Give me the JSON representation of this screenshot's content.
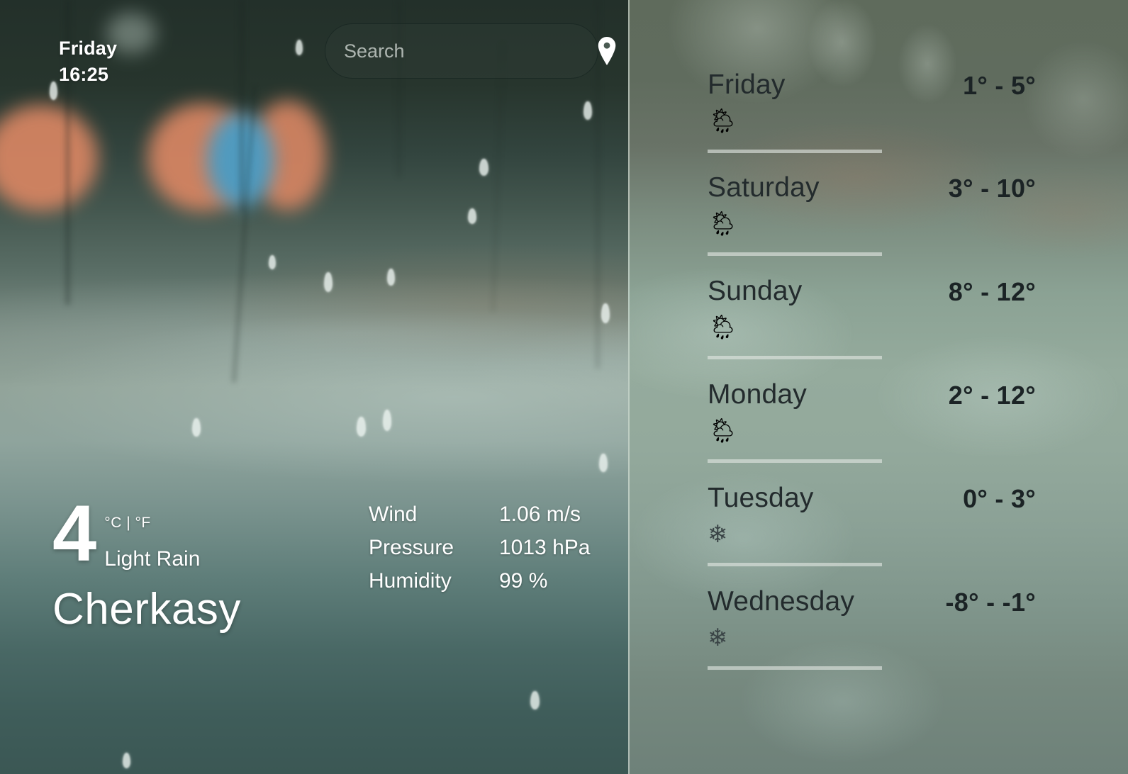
{
  "header": {
    "day": "Friday",
    "time": "16:25"
  },
  "search": {
    "placeholder": "Search",
    "value": "",
    "location_icon": "location-pin-icon"
  },
  "current": {
    "temperature": "4",
    "units_toggle": "°C | °F",
    "unit_celsius": "°C",
    "unit_separator": "|",
    "unit_fahrenheit": "°F",
    "condition": "Light Rain",
    "city": "Cherkasy"
  },
  "readings": [
    {
      "label": "Wind",
      "value": "1.06 m/s"
    },
    {
      "label": "Pressure",
      "value": "1013 hPa"
    },
    {
      "label": "Humidity",
      "value": "99 %"
    }
  ],
  "forecast": [
    {
      "day": "Friday",
      "range": "1° - 5°",
      "icon": "🌦",
      "icon_name": "sun-behind-rain-cloud-icon"
    },
    {
      "day": "Saturday",
      "range": "3° - 10°",
      "icon": "🌦",
      "icon_name": "sun-behind-rain-cloud-icon"
    },
    {
      "day": "Sunday",
      "range": "8° - 12°",
      "icon": "🌦",
      "icon_name": "sun-behind-rain-cloud-icon"
    },
    {
      "day": "Monday",
      "range": "2° - 12°",
      "icon": "🌦",
      "icon_name": "sun-behind-rain-cloud-icon"
    },
    {
      "day": "Tuesday",
      "range": "0° - 3°",
      "icon": "❄",
      "icon_name": "snowflake-icon"
    },
    {
      "day": "Wednesday",
      "range": "-8° - -1°",
      "icon": "❄",
      "icon_name": "snowflake-icon"
    }
  ],
  "colors": {
    "text_light": "#ffffff",
    "forecast_text": "#232b2d",
    "forecast_range": "#1b2325",
    "divider": "#e2e7e2",
    "bokeh_orange": "#d98663",
    "bokeh_blue": "#4a9cc4"
  }
}
